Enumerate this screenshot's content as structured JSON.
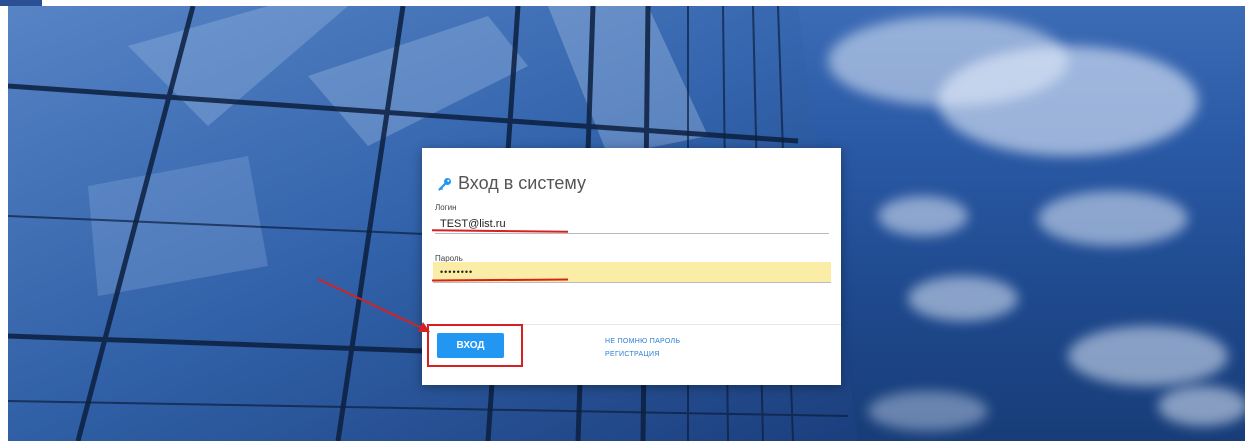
{
  "login_form": {
    "title": "Вход в систему",
    "login_label": "Логин",
    "login_value": "TEST@list.ru",
    "password_label": "Пароль",
    "password_value": "••••••••",
    "submit_label": "ВХОД",
    "forgot_password_link": "НЕ ПОМНЮ ПАРОЛЬ",
    "register_link": "РЕГИСТРАЦИЯ"
  },
  "icons": {
    "title_icon": "key-icon"
  },
  "colors": {
    "primary_button": "#2196f3",
    "link": "#2a7dd4",
    "password_field_autofill": "#fbeda5",
    "annotation_red": "#d42222"
  }
}
